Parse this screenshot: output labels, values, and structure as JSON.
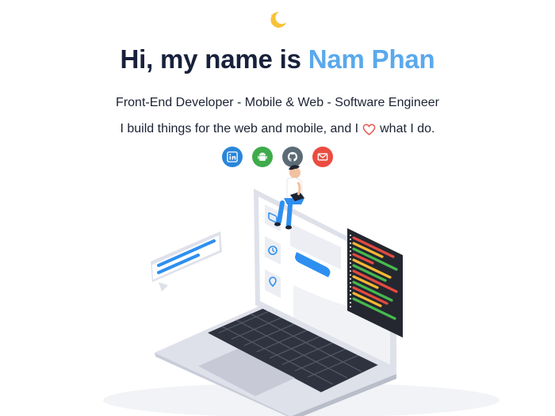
{
  "theme_toggle": {
    "icon": "moon-star-icon",
    "color": "#f7c23a"
  },
  "hero": {
    "greeting": "Hi, my name is",
    "name": "Nam Phan",
    "name_color": "#5aa9ec",
    "subtitle": "Front-End Developer - Mobile & Web - Software Engineer",
    "tagline_before": "I build things for the web and mobile, and I",
    "tagline_icon": "heart-icon",
    "tagline_after": "what I do."
  },
  "socials": [
    {
      "icon": "linkedin-icon",
      "color": "#2a86d9"
    },
    {
      "icon": "android-icon",
      "color": "#3fab4b"
    },
    {
      "icon": "github-icon",
      "color": "#5b6b76"
    },
    {
      "icon": "mail-icon",
      "color": "#ea4c41"
    }
  ],
  "illustration": {
    "subject": "laptop-developer-illustration",
    "accent": "#2e8ff0"
  }
}
